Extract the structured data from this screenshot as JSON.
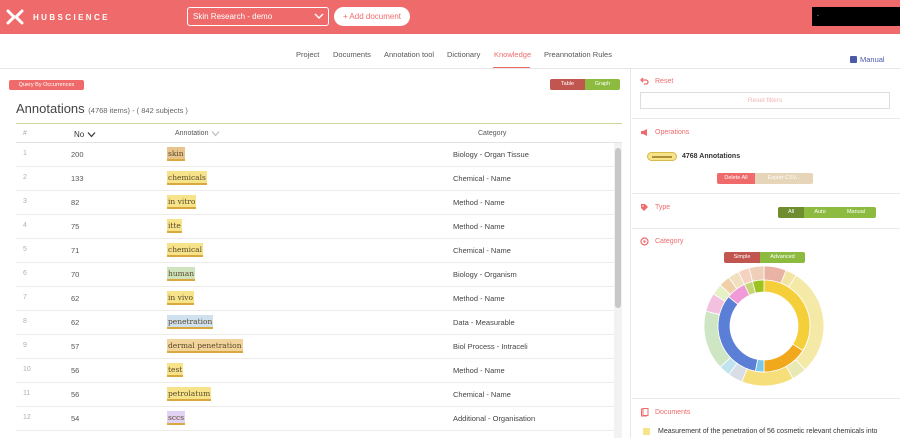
{
  "app": {
    "brand": "HUBSCIENCE",
    "project_selected": "Skin Research - demo",
    "add_document_label": "+ Add document",
    "user_label": "."
  },
  "nav": {
    "items": [
      "Project",
      "Documents",
      "Annotation tool",
      "Dictionary",
      "Knowledge",
      "Preannotation Rules"
    ],
    "active": "Knowledge",
    "manual_label": "Manual"
  },
  "left": {
    "query_button": "Query By Occurrences",
    "view_toggle": {
      "table": "Table",
      "graph": "Graph"
    },
    "title": "Annotations",
    "subtitle": "(4768 items) - ( 842 subjects )",
    "columns": {
      "index": "#",
      "no": "No",
      "annotation": "Annotation",
      "category": "Category"
    },
    "rows": [
      {
        "i": "1",
        "no": "200",
        "ann": "skin",
        "cat": "Biology - Organ Tissue",
        "color": "#e9c48d"
      },
      {
        "i": "2",
        "no": "133",
        "ann": "chemicals",
        "cat": "Chemical - Name",
        "color": "#f6e38a"
      },
      {
        "i": "3",
        "no": "82",
        "ann": "in vitro",
        "cat": "Method - Name",
        "color": "#f6e38a"
      },
      {
        "i": "4",
        "no": "75",
        "ann": "itte",
        "cat": "Method - Name",
        "color": "#f6e38a"
      },
      {
        "i": "5",
        "no": "71",
        "ann": "chemical",
        "cat": "Chemical - Name",
        "color": "#f6e38a"
      },
      {
        "i": "6",
        "no": "70",
        "ann": "human",
        "cat": "Biology - Organism",
        "color": "#cfe3bd"
      },
      {
        "i": "7",
        "no": "62",
        "ann": "in vivo",
        "cat": "Method - Name",
        "color": "#f6e38a"
      },
      {
        "i": "8",
        "no": "62",
        "ann": "penetration",
        "cat": "Data - Measurable",
        "color": "#cfe0ee"
      },
      {
        "i": "9",
        "no": "57",
        "ann": "dermal penetration",
        "cat": "Biol Process - Intraceli",
        "color": "#f1d39b"
      },
      {
        "i": "10",
        "no": "56",
        "ann": "test",
        "cat": "Method - Name",
        "color": "#f6e38a"
      },
      {
        "i": "11",
        "no": "56",
        "ann": "petrolatum",
        "cat": "Chemical - Name",
        "color": "#f6e38a"
      },
      {
        "i": "12",
        "no": "54",
        "ann": "sccs",
        "cat": "Additional - Organisation",
        "color": "#e2d2f3"
      }
    ]
  },
  "right": {
    "reset": {
      "title": "Reset",
      "button": "Reset filters"
    },
    "operations": {
      "title": "Operations",
      "count_label": "4768 Annotations",
      "delete": "Delete All",
      "export": "Export CSV..."
    },
    "type": {
      "title": "Type",
      "all": "All",
      "auto": "Auto",
      "manual": "Manual"
    },
    "category": {
      "title": "Category",
      "simple": "Simple",
      "advanced": "Advanced"
    },
    "documents": {
      "title": "Documents",
      "first_doc": "Measurement of the penetration of 56 cosmetic relevant chemicals into"
    }
  },
  "colors": {
    "brand": "#ef6b6b",
    "toggle_dark": "#c0564f",
    "toggle_green": "#8dbb3f",
    "link_blue": "#4a5aa8"
  },
  "chart_data": {
    "type": "pie",
    "inner": [
      {
        "value": 34,
        "color": "#f5cf3a"
      },
      {
        "value": 16,
        "color": "#f2a81c"
      },
      {
        "value": 3,
        "color": "#7dc7e8"
      },
      {
        "value": 33,
        "color": "#5b7fd6"
      },
      {
        "value": 7,
        "color": "#f19ad8"
      },
      {
        "value": 3,
        "color": "#c7d57a"
      },
      {
        "value": 4,
        "color": "#9cc31f"
      }
    ],
    "outer": [
      {
        "value": 6,
        "color": "#e8b2a4"
      },
      {
        "value": 3,
        "color": "#f3e4a5"
      },
      {
        "value": 29,
        "color": "#f5e9a8"
      },
      {
        "value": 4,
        "color": "#e9e9b5"
      },
      {
        "value": 14,
        "color": "#f6df7a"
      },
      {
        "value": 4,
        "color": "#d9dee6"
      },
      {
        "value": 3,
        "color": "#bfe3ef"
      },
      {
        "value": 16,
        "color": "#cfe6c4"
      },
      {
        "value": 5,
        "color": "#f3c0e0"
      },
      {
        "value": 3,
        "color": "#e6f0c6"
      },
      {
        "value": 3,
        "color": "#f0d0a8"
      },
      {
        "value": 3,
        "color": "#f1e0c0"
      },
      {
        "value": 3,
        "color": "#f5d2c0"
      },
      {
        "value": 4,
        "color": "#efcfb8"
      }
    ]
  }
}
